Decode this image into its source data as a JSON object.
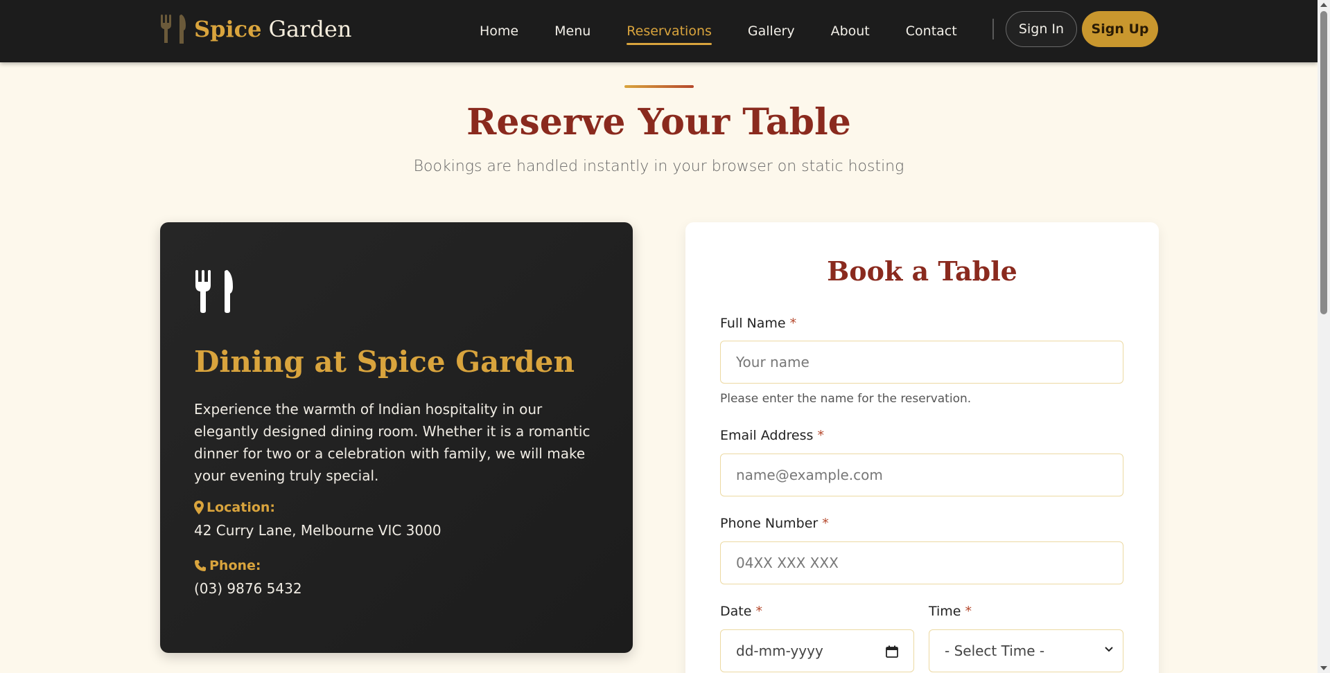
{
  "brand": {
    "name_accent": "Spice",
    "name_rest": "Garden",
    "icon": "utensils-icon"
  },
  "nav": {
    "links": [
      {
        "label": "Home",
        "active": false
      },
      {
        "label": "Menu",
        "active": false
      },
      {
        "label": "Reservations",
        "active": true
      },
      {
        "label": "Gallery",
        "active": false
      },
      {
        "label": "About",
        "active": false
      },
      {
        "label": "Contact",
        "active": false
      }
    ],
    "sign_in": "Sign In",
    "sign_up": "Sign Up"
  },
  "header": {
    "title": "Reserve Your Table",
    "subtitle": "Bookings are handled instantly in your browser on static hosting"
  },
  "info_card": {
    "icon": "utensils-icon",
    "title": "Dining at Spice Garden",
    "description": "Experience the warmth of Indian hospitality in our elegantly designed dining room. Whether it is a romantic dinner for two or a celebration with family, we will make your evening truly special.",
    "location_label": "Location:",
    "location_value": "42 Curry Lane, Melbourne VIC 3000",
    "phone_label": "Phone:",
    "phone_value": "(03) 9876 5432"
  },
  "form": {
    "title": "Book a Table",
    "full_name": {
      "label": "Full Name",
      "required": "*",
      "placeholder": "Your name",
      "help": "Please enter the name for the reservation."
    },
    "email": {
      "label": "Email Address",
      "required": "*",
      "placeholder": "name@example.com"
    },
    "phone": {
      "label": "Phone Number",
      "required": "*",
      "placeholder": "04XX XXX XXX"
    },
    "date": {
      "label": "Date",
      "required": "*",
      "placeholder": "dd-mm-yyyy"
    },
    "time": {
      "label": "Time",
      "required": "*",
      "selected": "- Select Time -"
    }
  },
  "colors": {
    "accent": "#d9a43d",
    "heading": "#8a2a1e",
    "dark": "#1c1c1c",
    "background": "#fdf8ec"
  }
}
